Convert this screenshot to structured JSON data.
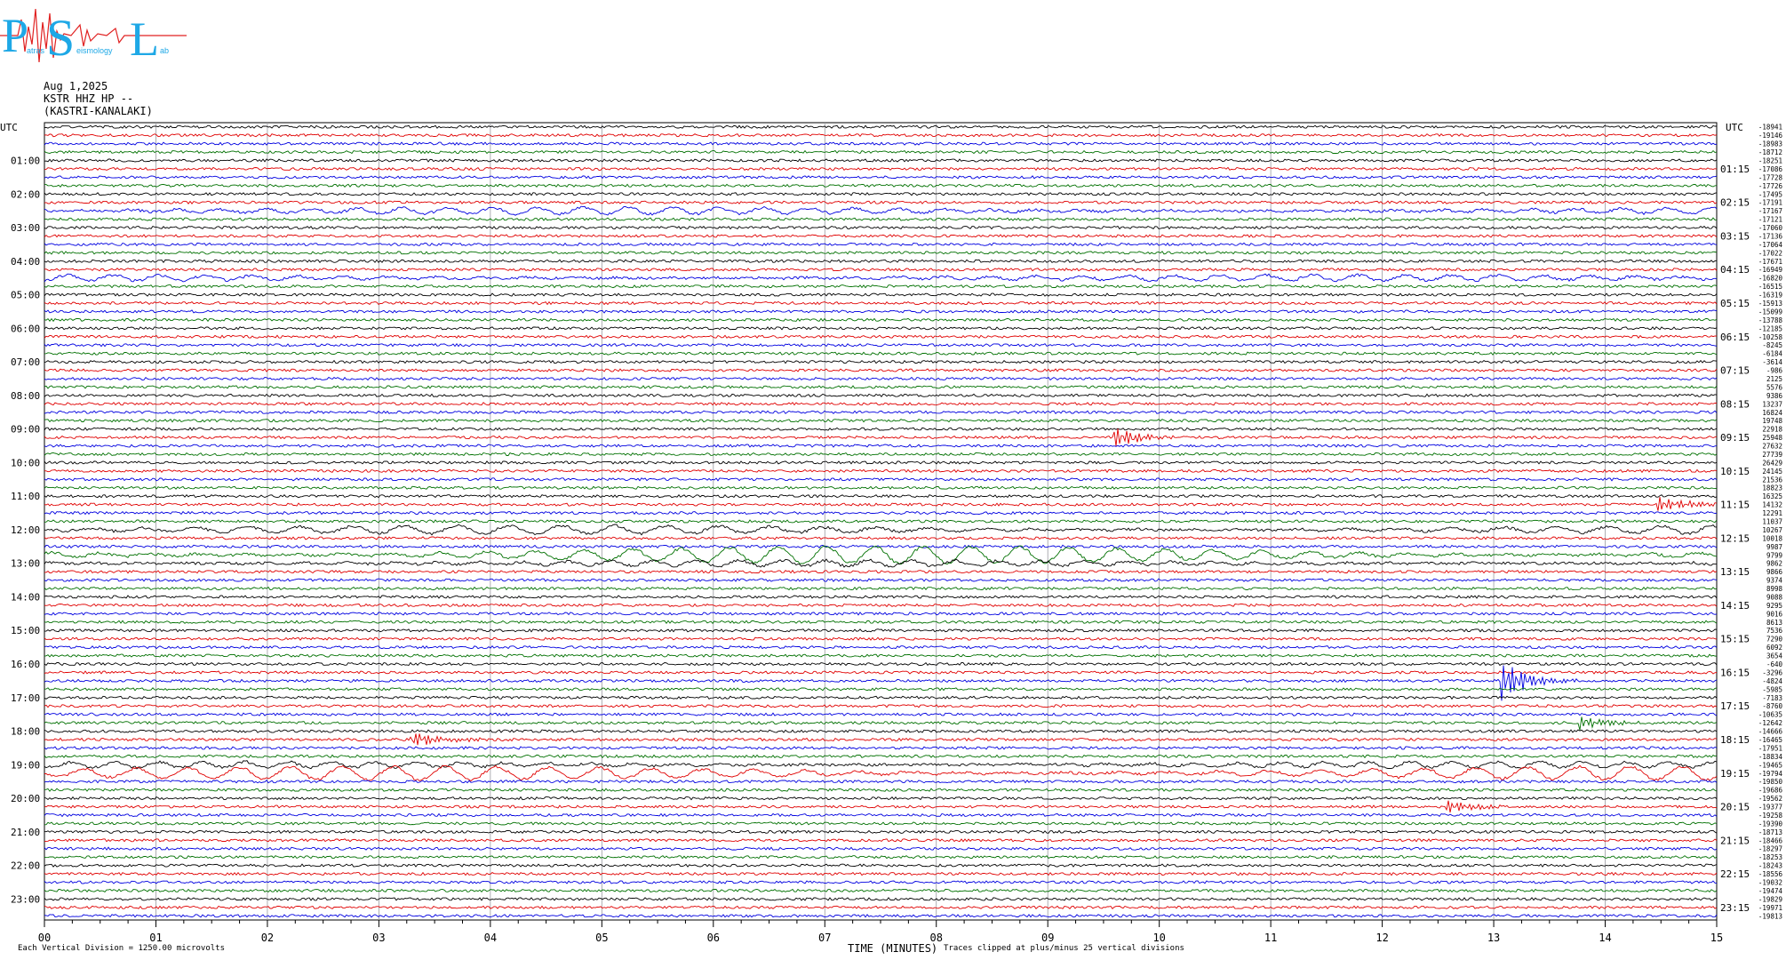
{
  "logo": {
    "letters": [
      "P",
      "S",
      "L"
    ],
    "subtitle_fragments": [
      "atras",
      "eismology",
      "ab"
    ]
  },
  "header": {
    "date": "Aug 1,2025",
    "station": "KSTR HHZ HP --",
    "location": "(KASTRI-KANALAKI)"
  },
  "footer": {
    "scale_note": "Each Vertical Division = 1250.00 microvolts",
    "xlabel": "TIME (MINUTES)",
    "clip_note": "Traces clipped at plus/minus 25 vertical divisions"
  },
  "colors": {
    "trace_cycle": [
      "#000000",
      "#e00000",
      "#0000e0",
      "#007000"
    ],
    "grid": "#9a9aa0"
  },
  "chart_data": {
    "type": "line",
    "xlabel": "TIME (MINUTES)",
    "xlim": [
      0,
      15
    ],
    "x_ticks": [
      "00",
      "01",
      "02",
      "03",
      "04",
      "05",
      "06",
      "07",
      "08",
      "09",
      "10",
      "11",
      "12",
      "13",
      "14",
      "15"
    ],
    "left_axis_label": "UTC",
    "right_axis_label": "UTC",
    "left_time_labels": [
      "01:00",
      "02:00",
      "03:00",
      "04:00",
      "05:00",
      "06:00",
      "07:00",
      "08:00",
      "09:00",
      "10:00",
      "11:00",
      "12:00",
      "13:00",
      "14:00",
      "15:00",
      "16:00",
      "17:00",
      "18:00",
      "19:00",
      "20:00",
      "21:00",
      "22:00",
      "23:00"
    ],
    "right_time_labels": [
      "01:15",
      "02:15",
      "03:15",
      "04:15",
      "05:15",
      "06:15",
      "07:15",
      "08:15",
      "09:15",
      "10:15",
      "11:15",
      "12:15",
      "13:15",
      "14:15",
      "15:15",
      "16:15",
      "17:15",
      "18:15",
      "19:15",
      "20:15",
      "21:15",
      "22:15",
      "23:15"
    ],
    "trace_offsets": [
      "-18941",
      "-19146",
      "-18983",
      "-18712",
      "-18251",
      "-17086",
      "-17728",
      "-17726",
      "-17495",
      "-17191",
      "-17167",
      "-17121",
      "-17060",
      "-17136",
      "-17064",
      "-17022",
      "-17671",
      "-16949",
      "-16820",
      "-16515",
      "-16319",
      "-15913",
      "-15099",
      "-13788",
      "-12185",
      "-10258",
      "-8245",
      "-6184",
      "-3614",
      "-986",
      "2125",
      "5576",
      "9386",
      "13237",
      "16824",
      "19748",
      "22918",
      "25948",
      "27632",
      "27739",
      "26429",
      "24145",
      "21536",
      "18823",
      "16325",
      "14132",
      "12291",
      "11037",
      "10267",
      "10018",
      "9987",
      "9799",
      "9862",
      "9866",
      "9374",
      "8998",
      "9088",
      "9295",
      "9016",
      "8613",
      "7536",
      "7290",
      "6092",
      "3654",
      "-640",
      "-3296",
      "-4824",
      "-5985",
      "-7183",
      "-8760",
      "-10635",
      "-12642",
      "-14666",
      "-16465",
      "-17951",
      "-18834",
      "-19465",
      "-19794",
      "-19850",
      "-19686",
      "-19562",
      "-19377",
      "-19258",
      "-19390",
      "-18713",
      "-18466",
      "-18297",
      "-18253",
      "-18243",
      "-18556",
      "-19032",
      "-19474",
      "-19829",
      "-19971",
      "-19813"
    ],
    "events": [
      {
        "trace": 37,
        "minute": 9.6,
        "amplitude": 0.5
      },
      {
        "trace": 45,
        "minute": 14.5,
        "amplitude": 0.4
      },
      {
        "trace": 66,
        "minute": 13.1,
        "amplitude": 0.9
      },
      {
        "trace": 71,
        "minute": 13.8,
        "amplitude": 0.3
      },
      {
        "trace": 73,
        "minute": 3.3,
        "amplitude": 0.4
      },
      {
        "trace": 81,
        "minute": 12.6,
        "amplitude": 0.3
      }
    ],
    "long_period_traces": [
      {
        "trace": 10,
        "amplitude": 0.4
      },
      {
        "trace": 18,
        "amplitude": 0.35
      },
      {
        "trace": 48,
        "amplitude": 0.5
      },
      {
        "trace": 51,
        "amplitude": 1.0
      },
      {
        "trace": 52,
        "amplitude": 0.35
      },
      {
        "trace": 76,
        "amplitude": 0.35
      },
      {
        "trace": 77,
        "amplitude": 0.8
      }
    ]
  }
}
